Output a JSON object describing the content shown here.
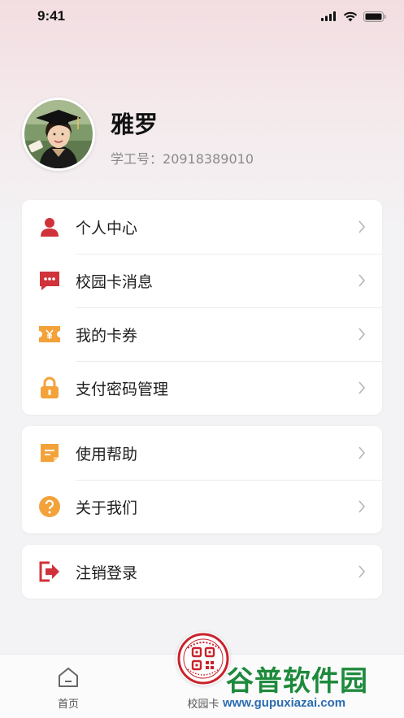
{
  "status_bar": {
    "time": "9:41"
  },
  "profile": {
    "name": "雅罗",
    "id_label": "学工号：",
    "id_value": "20918389010"
  },
  "menu_group_1": [
    {
      "label": "个人中心",
      "icon": "person-icon"
    },
    {
      "label": "校园卡消息",
      "icon": "message-icon"
    },
    {
      "label": "我的卡券",
      "icon": "coupon-icon"
    },
    {
      "label": "支付密码管理",
      "icon": "lock-icon"
    }
  ],
  "menu_group_2": [
    {
      "label": "使用帮助",
      "icon": "help-doc-icon"
    },
    {
      "label": "关于我们",
      "icon": "question-icon"
    }
  ],
  "menu_group_3": [
    {
      "label": "注销登录",
      "icon": "logout-icon"
    }
  ],
  "tabbar": {
    "home_label": "首页",
    "card_label": "校园卡"
  },
  "watermark": {
    "title": "谷普软件园",
    "url": "www.gupuxiazai.com"
  },
  "colors": {
    "accent_red": "#d0323a",
    "accent_orange": "#f3a23a",
    "watermark_green": "#1e8a3c"
  }
}
